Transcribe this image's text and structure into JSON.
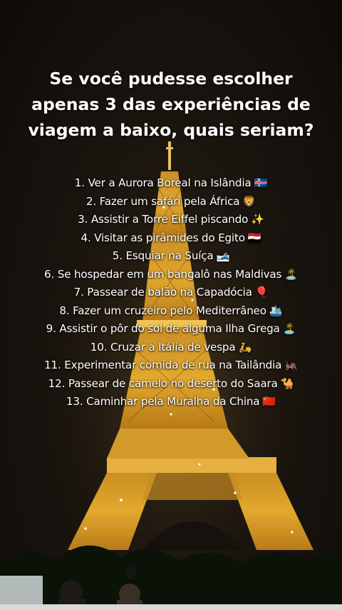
{
  "title_lines": [
    "Se você pudesse escolher",
    "apenas 3 das experiências de",
    "viagem a baixo, quais seriam?"
  ],
  "items": [
    {
      "text": "1. Ver a Aurora Boreal na Islândia",
      "emoji": "🇮🇸"
    },
    {
      "text": "2. Fazer um safári pela África",
      "emoji": "🦁"
    },
    {
      "text": "3. Assistir a Torre Eiffel piscando",
      "emoji": "✨"
    },
    {
      "text": "4. Visitar as pirâmides do Egito",
      "emoji": "🇪🇬"
    },
    {
      "text": "5. Esquiar na Suíça",
      "emoji": "🎿"
    },
    {
      "text": "6. Se hospedar em um bangalô nas Maldivas",
      "emoji": "🏝️"
    },
    {
      "text": "7. Passear de balão na Capadócia",
      "emoji": "🎈"
    },
    {
      "text": "8. Fazer um cruzeiro pelo Mediterrâneo",
      "emoji": "🛳️"
    },
    {
      "text": "9. Assistir o pôr do sol de alguma Ilha Grega",
      "emoji": "🏝️"
    },
    {
      "text": "10. Cruzar a Itália de vespa",
      "emoji": "🛵"
    },
    {
      "text": "11. Experimentar comida de rua na Tailândia",
      "emoji": "🦗"
    },
    {
      "text": "12. Passear de camelo no deserto do Saara",
      "emoji": "🐪"
    },
    {
      "text": "13. Caminhar pela Muralha da China",
      "emoji": "🇨🇳"
    }
  ],
  "colors": {
    "text": "#ffffff",
    "tower_light": "#f2b83a",
    "background": "#15110c"
  }
}
